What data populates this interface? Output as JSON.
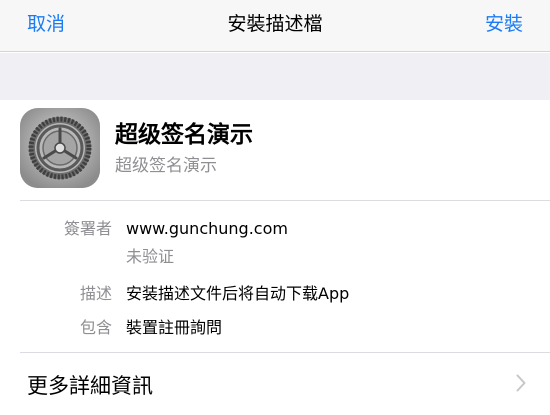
{
  "navbar": {
    "cancel_label": "取消",
    "title": "安裝描述檔",
    "install_label": "安裝",
    "accent_color": "#1a7cf5"
  },
  "profile": {
    "name": "超级签名演示",
    "subtitle": "超级签名演示",
    "icon": "settings-gear-icon"
  },
  "details": {
    "signer_label": "簽署者",
    "signer_value": "www.gunchung.com",
    "signer_status": "未验证",
    "description_label": "描述",
    "description_value": "安装描述文件后将自动下载App",
    "contains_label": "包含",
    "contains_value": "裝置註冊詢問"
  },
  "more": {
    "label": "更多詳細資訊",
    "chevron_icon": "chevron-right-icon"
  }
}
